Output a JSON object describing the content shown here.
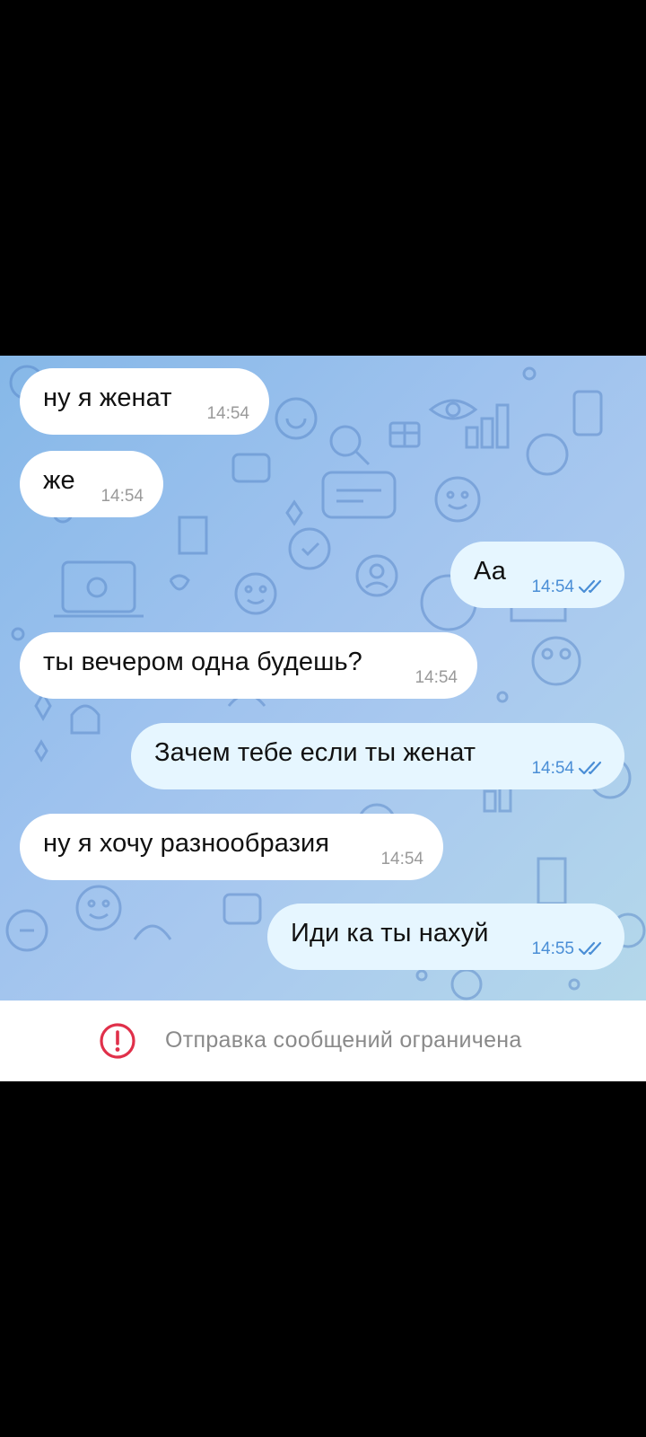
{
  "chat": {
    "messages": [
      {
        "direction": "in",
        "text": "ну я женат",
        "time": "14:54"
      },
      {
        "direction": "in",
        "text": "же",
        "time": "14:54"
      },
      {
        "direction": "out",
        "text": "Аа",
        "time": "14:54",
        "status": "read"
      },
      {
        "direction": "in",
        "text": "ты вечером одна будешь?",
        "time": "14:54"
      },
      {
        "direction": "out",
        "text": "Зачем тебе если ты женат",
        "time": "14:54",
        "status": "read"
      },
      {
        "direction": "in",
        "text": "ну я хочу разнообразия",
        "time": "14:54"
      },
      {
        "direction": "out",
        "text": "Иди ка ты нахуй",
        "time": "14:55",
        "status": "read"
      }
    ]
  },
  "footer": {
    "restricted_text": "Отправка сообщений ограничена",
    "icon": "exclamation-circle-icon"
  },
  "colors": {
    "incoming_bubble": "#ffffff",
    "outgoing_bubble": "#e6f6ff",
    "outgoing_time": "#4a8ed6",
    "alert_icon": "#e0304a",
    "wallpaper": "#9ec2ee"
  }
}
